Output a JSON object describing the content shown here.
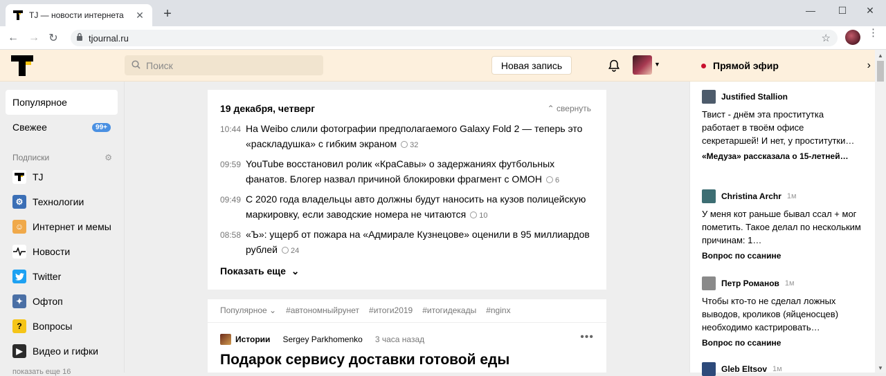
{
  "browser": {
    "tab_title": "TJ — новости интернета",
    "url": "tjournal.ru",
    "controls": {
      "minimize": "—",
      "maximize": "☐",
      "close": "✕"
    }
  },
  "header": {
    "search_placeholder": "Поиск",
    "new_post_label": "Новая запись",
    "live_label": "Прямой эфир"
  },
  "sidebar": {
    "items": [
      {
        "label": "Популярное"
      },
      {
        "label": "Свежее",
        "badge": "99+"
      }
    ],
    "subscriptions_label": "Подписки",
    "subscriptions": [
      {
        "label": "TJ",
        "icon": "tj-logo-icon",
        "color": "#ffffff"
      },
      {
        "label": "Технологии",
        "icon": "tech-icon",
        "color": "#3b6fb6"
      },
      {
        "label": "Интернет и мемы",
        "icon": "meme-icon",
        "color": "#f0a94a"
      },
      {
        "label": "Новости",
        "icon": "news-icon",
        "color": "#ffffff"
      },
      {
        "label": "Twitter",
        "icon": "twitter-icon",
        "color": "#1da1f2"
      },
      {
        "label": "Офтоп",
        "icon": "offtop-icon",
        "color": "#4a6fa5"
      },
      {
        "label": "Вопросы",
        "icon": "question-icon",
        "color": "#f5c518"
      },
      {
        "label": "Видео и гифки",
        "icon": "video-icon",
        "color": "#2b2b2b"
      }
    ],
    "more_label": "показать еще 16"
  },
  "feed": {
    "date_label": "19 декабря, четверг",
    "collapse_label": "свернуть",
    "news": [
      {
        "time": "10:44",
        "text": "На Weibo слили фотографии предполагаемого Galaxy Fold 2 — теперь это «раскладушка» с гибким экраном",
        "comments": "32"
      },
      {
        "time": "09:59",
        "text": "YouTube восстановил ролик «КраСавы» о задержаниях футбольных фанатов. Блогер назвал причиной блокировки фрагмент с ОМОН",
        "comments": "6"
      },
      {
        "time": "09:49",
        "text": "С 2020 года владельцы авто должны будут наносить на кузов полицейскую маркировку, если заводские номера не читаются",
        "comments": "10"
      },
      {
        "time": "08:58",
        "text": "«Ъ»: ущерб от пожара на «Адмирале Кузнецове» оценили в 95 миллиардов рублей",
        "comments": "24"
      }
    ],
    "show_more_label": "Показать еще",
    "tags": [
      "Популярное",
      "#автономныйрунет",
      "#итоги2019",
      "#итогидекады",
      "#nginx"
    ],
    "article": {
      "category": "Истории",
      "author": "Sergey Parkhomenko",
      "time": "3 часа назад",
      "title": "Подарок сервису доставки готовой еды"
    }
  },
  "live_comments": [
    {
      "author": "Justified Stallion",
      "ago": "",
      "text": "Твист - днём эта проститутка работает в твоём офисе секретаршей! И нет, у проститутки…",
      "post": "«Медуза» рассказала о 15-летней…",
      "avatar_color": "#4d5b6b"
    },
    {
      "author": "Christina Archr",
      "ago": "1м",
      "text": "У меня кот раньше бывал ссал + мог пометить. Такое делал по нескольким причинам: 1…",
      "post": "Вопрос по ссанине",
      "avatar_color": "#3d6e73"
    },
    {
      "author": "Петр Романов",
      "ago": "1м",
      "text": "Чтобы кто-то не сделал ложных выводов, кроликов (яйценосцев) необходимо кастрировать…",
      "post": "Вопрос по ссанине",
      "avatar_color": "#8a8a8a"
    },
    {
      "author": "Gleb Eltsov",
      "ago": "1м",
      "text": "",
      "post": "",
      "avatar_color": "#2d4a7a"
    }
  ]
}
